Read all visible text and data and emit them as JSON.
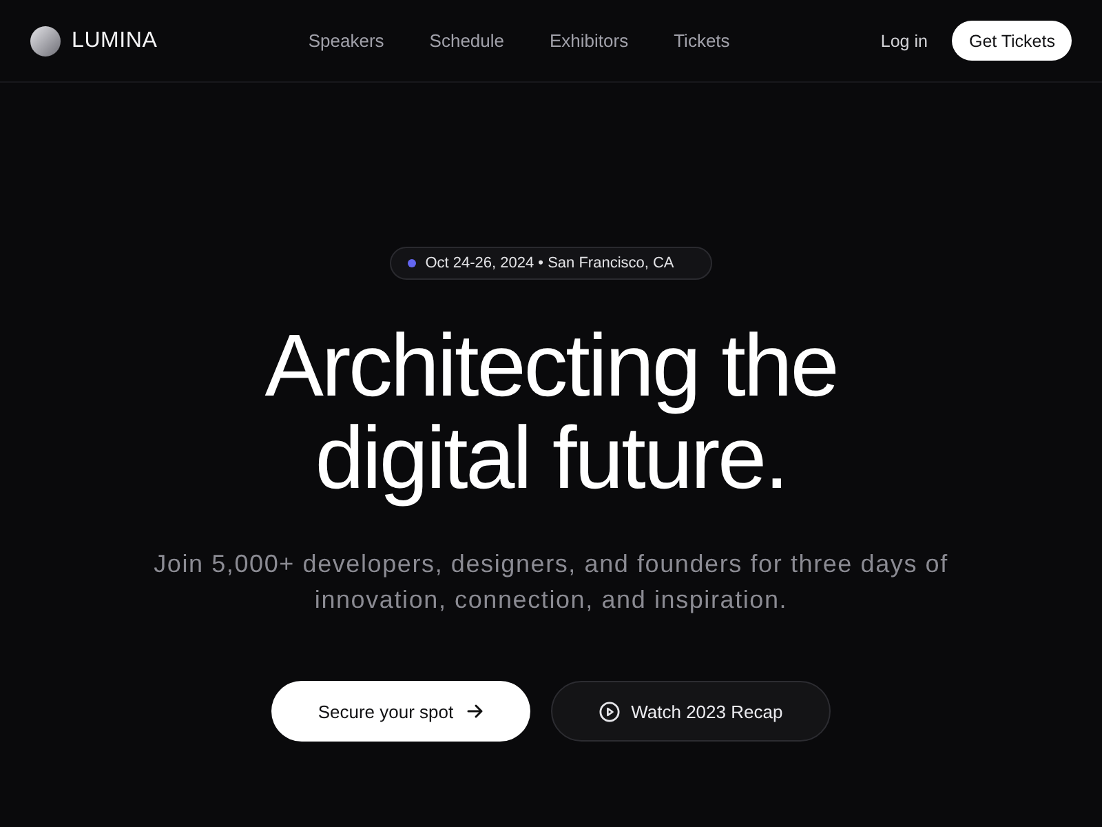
{
  "header": {
    "logo": "LUMINA",
    "nav": [
      {
        "label": "Speakers"
      },
      {
        "label": "Schedule"
      },
      {
        "label": "Exhibitors"
      },
      {
        "label": "Tickets"
      }
    ],
    "login": "Log in",
    "cta": "Get Tickets"
  },
  "hero": {
    "badge": "Oct 24-26, 2024 • San Francisco, CA",
    "headline": "Architecting the digital future.",
    "subtitle": "Join 5,000+ developers, designers, and founders for three days of innovation, connection, and inspiration.",
    "buttons": [
      {
        "kind": "primary",
        "label": "Secure your spot"
      },
      {
        "kind": "secondary",
        "label": "Watch 2023 Recap"
      }
    ]
  }
}
